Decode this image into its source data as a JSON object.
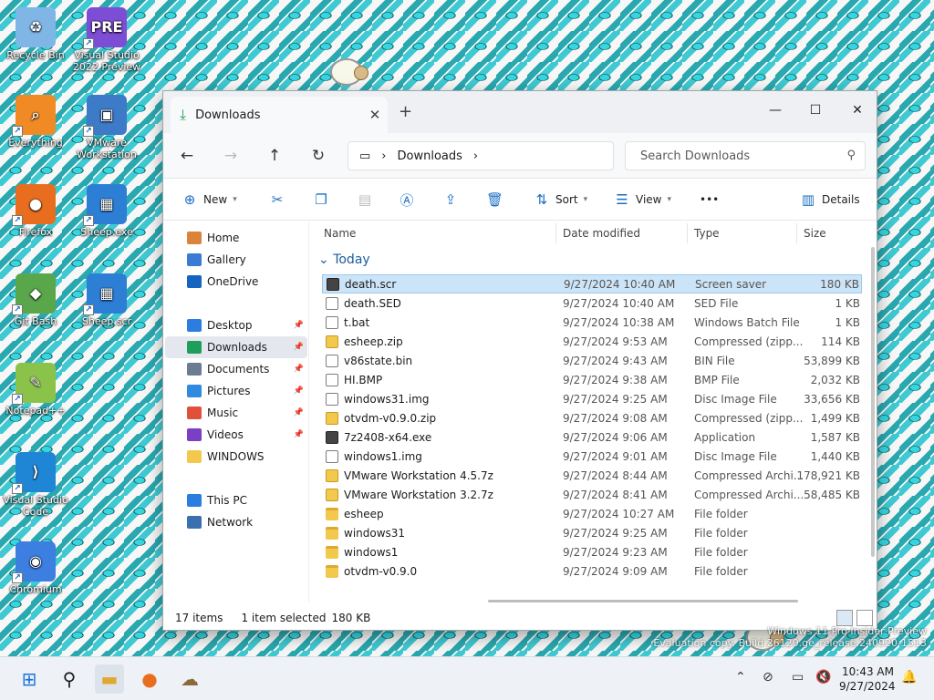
{
  "desktop": {
    "icons": [
      {
        "label": "Recycle Bin",
        "color": "#7fb6e6",
        "glyph": "♻"
      },
      {
        "label": "Visual Studio 2022 Preview",
        "color": "#7e4dd6",
        "glyph": "PRE"
      },
      {
        "label": "Everything",
        "color": "#f08a24",
        "glyph": "⌕"
      },
      {
        "label": "VMware Workstation",
        "color": "#3d7ac7",
        "glyph": "▣"
      },
      {
        "label": "Firefox",
        "color": "#e96d1f",
        "glyph": "●"
      },
      {
        "label": "Sheep.exe",
        "color": "#2d7fd6",
        "glyph": "▦"
      },
      {
        "label": "Git Bash",
        "color": "#5aa64b",
        "glyph": "◆"
      },
      {
        "label": "Sheep.scr",
        "color": "#2d7fd6",
        "glyph": "▦"
      },
      {
        "label": "Notepad++",
        "color": "#8bc34a",
        "glyph": "✎"
      },
      {
        "label": "Visual Studio Code",
        "color": "#1f86d6",
        "glyph": "⟩"
      },
      {
        "label": "Chromium",
        "color": "#3c7fe0",
        "glyph": "◉"
      }
    ],
    "watermark_line1": "Windows 11 Pro Insider Preview",
    "watermark_line2": "Evaluation copy. Build 26120.ge_release.240920-1513"
  },
  "window": {
    "tab_title": "Downloads",
    "new_tab": "+",
    "minimize": "—",
    "maximize": "☐",
    "close": "✕",
    "address_location": "Downloads",
    "search_placeholder": "Search Downloads",
    "commands": {
      "new": "New",
      "sort": "Sort",
      "view": "View",
      "more": "•••",
      "details": "Details"
    },
    "sidebar": [
      {
        "label": "Home",
        "color": "#d9843a",
        "pinned": false
      },
      {
        "label": "Gallery",
        "color": "#3a7bd5",
        "pinned": false
      },
      {
        "label": "OneDrive",
        "color": "#1565c0",
        "pinned": false
      },
      {
        "label": "Desktop",
        "color": "#2b7de0",
        "pinned": true
      },
      {
        "label": "Downloads",
        "color": "#1e9e5a",
        "pinned": true
      },
      {
        "label": "Documents",
        "color": "#6b7c93",
        "pinned": true
      },
      {
        "label": "Pictures",
        "color": "#2f8ae0",
        "pinned": true
      },
      {
        "label": "Music",
        "color": "#e0503a",
        "pinned": true
      },
      {
        "label": "Videos",
        "color": "#7b3fc4",
        "pinned": true
      },
      {
        "label": "WINDOWS",
        "color": "#f2c94c",
        "pinned": false
      },
      {
        "label": "This PC",
        "color": "#2b7de0",
        "pinned": false
      },
      {
        "label": "Network",
        "color": "#3a6fb0",
        "pinned": false
      }
    ],
    "columns": {
      "name": "Name",
      "date": "Date modified",
      "type": "Type",
      "size": "Size"
    },
    "group": "Today",
    "files": [
      {
        "name": "death.scr",
        "date": "9/27/2024 10:40 AM",
        "type": "Screen saver",
        "size": "180 KB",
        "kind": "exe",
        "selected": true
      },
      {
        "name": "death.SED",
        "date": "9/27/2024 10:40 AM",
        "type": "SED File",
        "size": "1 KB",
        "kind": "file"
      },
      {
        "name": "t.bat",
        "date": "9/27/2024 10:38 AM",
        "type": "Windows Batch File",
        "size": "1 KB",
        "kind": "file"
      },
      {
        "name": "esheep.zip",
        "date": "9/27/2024 9:53 AM",
        "type": "Compressed (zipp...",
        "size": "114 KB",
        "kind": "zip"
      },
      {
        "name": "v86state.bin",
        "date": "9/27/2024 9:43 AM",
        "type": "BIN File",
        "size": "53,899 KB",
        "kind": "file"
      },
      {
        "name": "HI.BMP",
        "date": "9/27/2024 9:38 AM",
        "type": "BMP File",
        "size": "2,032 KB",
        "kind": "file"
      },
      {
        "name": "windows31.img",
        "date": "9/27/2024 9:25 AM",
        "type": "Disc Image File",
        "size": "33,656 KB",
        "kind": "file"
      },
      {
        "name": "otvdm-v0.9.0.zip",
        "date": "9/27/2024 9:08 AM",
        "type": "Compressed (zipp...",
        "size": "1,499 KB",
        "kind": "zip"
      },
      {
        "name": "7z2408-x64.exe",
        "date": "9/27/2024 9:06 AM",
        "type": "Application",
        "size": "1,587 KB",
        "kind": "exe"
      },
      {
        "name": "windows1.img",
        "date": "9/27/2024 9:01 AM",
        "type": "Disc Image File",
        "size": "1,440 KB",
        "kind": "file"
      },
      {
        "name": "VMware Workstation 4.5.7z",
        "date": "9/27/2024 8:44 AM",
        "type": "Compressed Archi...",
        "size": "178,921 KB",
        "kind": "zip"
      },
      {
        "name": "VMware Workstation 3.2.7z",
        "date": "9/27/2024 8:41 AM",
        "type": "Compressed Archi...",
        "size": "58,485 KB",
        "kind": "zip"
      },
      {
        "name": "esheep",
        "date": "9/27/2024 10:27 AM",
        "type": "File folder",
        "size": "",
        "kind": "folder"
      },
      {
        "name": "windows31",
        "date": "9/27/2024 9:25 AM",
        "type": "File folder",
        "size": "",
        "kind": "folder"
      },
      {
        "name": "windows1",
        "date": "9/27/2024 9:23 AM",
        "type": "File folder",
        "size": "",
        "kind": "folder"
      },
      {
        "name": "otvdm-v0.9.0",
        "date": "9/27/2024 9:09 AM",
        "type": "File folder",
        "size": "",
        "kind": "folder"
      }
    ],
    "status": {
      "count": "17 items",
      "selection": "1 item selected",
      "size": "180 KB"
    }
  },
  "taskbar": {
    "time": "10:43 AM",
    "date": "9/27/2024"
  }
}
